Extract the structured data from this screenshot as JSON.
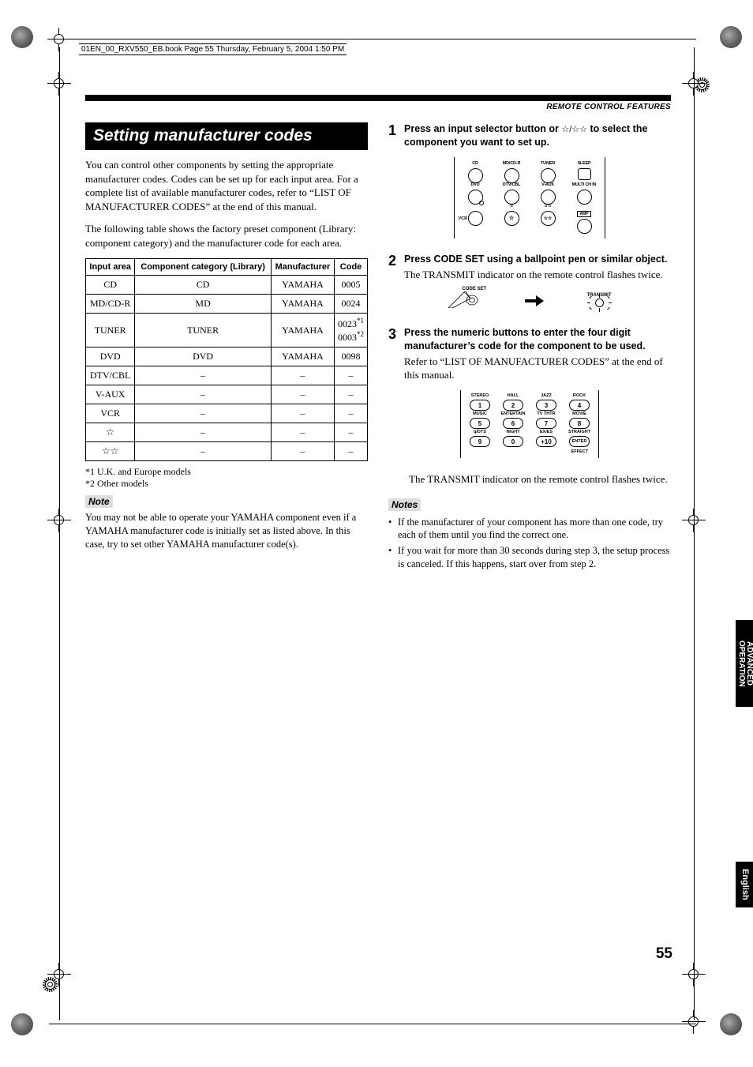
{
  "header_info": "01EN_00_RXV550_EB.book  Page 55  Thursday, February 5, 2004  1:50 PM",
  "section_header": "REMOTE CONTROL FEATURES",
  "title": "Setting manufacturer codes",
  "intro_p1": "You can control other components by setting the appropriate manufacturer codes. Codes can be set up for each input area. For a complete list of available manufacturer codes, refer to “LIST OF MANUFACTURER CODES” at the end of this manual.",
  "intro_p2": "The following table shows the factory preset component (Library: component category) and the manufacturer code for each area.",
  "table_headers": [
    "Input area",
    "Component category (Library)",
    "Manufacturer",
    "Code"
  ],
  "table_rows": [
    [
      "CD",
      "CD",
      "YAMAHA",
      "0005"
    ],
    [
      "MD/CD-R",
      "MD",
      "YAMAHA",
      "0024"
    ],
    [
      "TUNER",
      "TUNER",
      "YAMAHA",
      "0023*1 0003*2"
    ],
    [
      "DVD",
      "DVD",
      "YAMAHA",
      "0098"
    ],
    [
      "DTV/CBL",
      "–",
      "–",
      "–"
    ],
    [
      "V-AUX",
      "–",
      "–",
      "–"
    ],
    [
      "VCR",
      "–",
      "–",
      "–"
    ],
    [
      "☆",
      "–",
      "–",
      "–"
    ],
    [
      "☆☆",
      "–",
      "–",
      "–"
    ]
  ],
  "footnote1": "*1 U.K. and Europe models",
  "footnote2": "*2 Other models",
  "note_label": "Note",
  "note_text": "You may not be able to operate your YAMAHA component even if a YAMAHA manufacturer code is initially set as listed above. In this case, try to set other YAMAHA manufacturer code(s).",
  "step1": {
    "num": "1",
    "bold_a": "Press an input selector button or ",
    "bold_stars": "☆/☆☆",
    "bold_b": " to select the component you want to set up."
  },
  "remote_row1": [
    {
      "label": "CD",
      "type": "circle"
    },
    {
      "label": "MD/CD-R",
      "type": "circle"
    },
    {
      "label": "TUNER",
      "type": "circle"
    },
    {
      "label": "SLEEP",
      "type": "square"
    }
  ],
  "remote_row2": [
    {
      "label": "DVD",
      "type": "circle"
    },
    {
      "label": "DTV/CBL",
      "type": "circle"
    },
    {
      "label": "V-AUX",
      "type": "circle"
    },
    {
      "label": "MULTI CH IN",
      "type": "circle"
    }
  ],
  "remote_row3": [
    {
      "label": "VCR",
      "type": "circle"
    },
    {
      "label": "☆",
      "type": "circle"
    },
    {
      "label": "☆☆",
      "type": "circle"
    },
    {
      "label": "AMP",
      "type": "circle"
    }
  ],
  "step2": {
    "num": "2",
    "bold": "Press CODE SET using a ballpoint pen or similar object.",
    "text": "The TRANSMIT indicator on the remote control flashes twice."
  },
  "codeset_label": "CODE SET",
  "transmit_label": "TRANSMIT",
  "step3": {
    "num": "3",
    "bold": "Press the numeric buttons to enter the four digit manufacturer’s code for the component to be used.",
    "text": "Refer to “LIST OF MANUFACTURER CODES” at the end of this manual."
  },
  "numpad": [
    [
      {
        "l": "STEREO",
        "n": "1"
      },
      {
        "l": "HALL",
        "n": "2"
      },
      {
        "l": "JAZZ",
        "n": "3"
      },
      {
        "l": "ROCK",
        "n": "4"
      }
    ],
    [
      {
        "l": "MUSIC",
        "n": "5"
      },
      {
        "l": "ENTERTAIN",
        "n": "6"
      },
      {
        "l": "TV THTR",
        "n": "7"
      },
      {
        "l": "MOVIE",
        "n": "8"
      }
    ],
    [
      {
        "l": "q/DTS",
        "n": "9"
      },
      {
        "l": "NIGHT",
        "n": "0"
      },
      {
        "l": "EX/ES",
        "n": "+10"
      },
      {
        "l": "STRAIGHT",
        "n": "ENTER"
      }
    ]
  ],
  "effect_label": "EFFECT",
  "step3_after": "The TRANSMIT indicator on the remote control flashes twice.",
  "notes_label": "Notes",
  "notes": [
    "If the manufacturer of your component has more than one code, try each of them until you find the correct one.",
    "If you wait for more than 30 seconds during step 3, the setup process is canceled. If this happens, start over from step 2."
  ],
  "side_tab1_a": "ADVANCED",
  "side_tab1_b": "OPERATION",
  "side_tab2": "English",
  "page_num": "55"
}
